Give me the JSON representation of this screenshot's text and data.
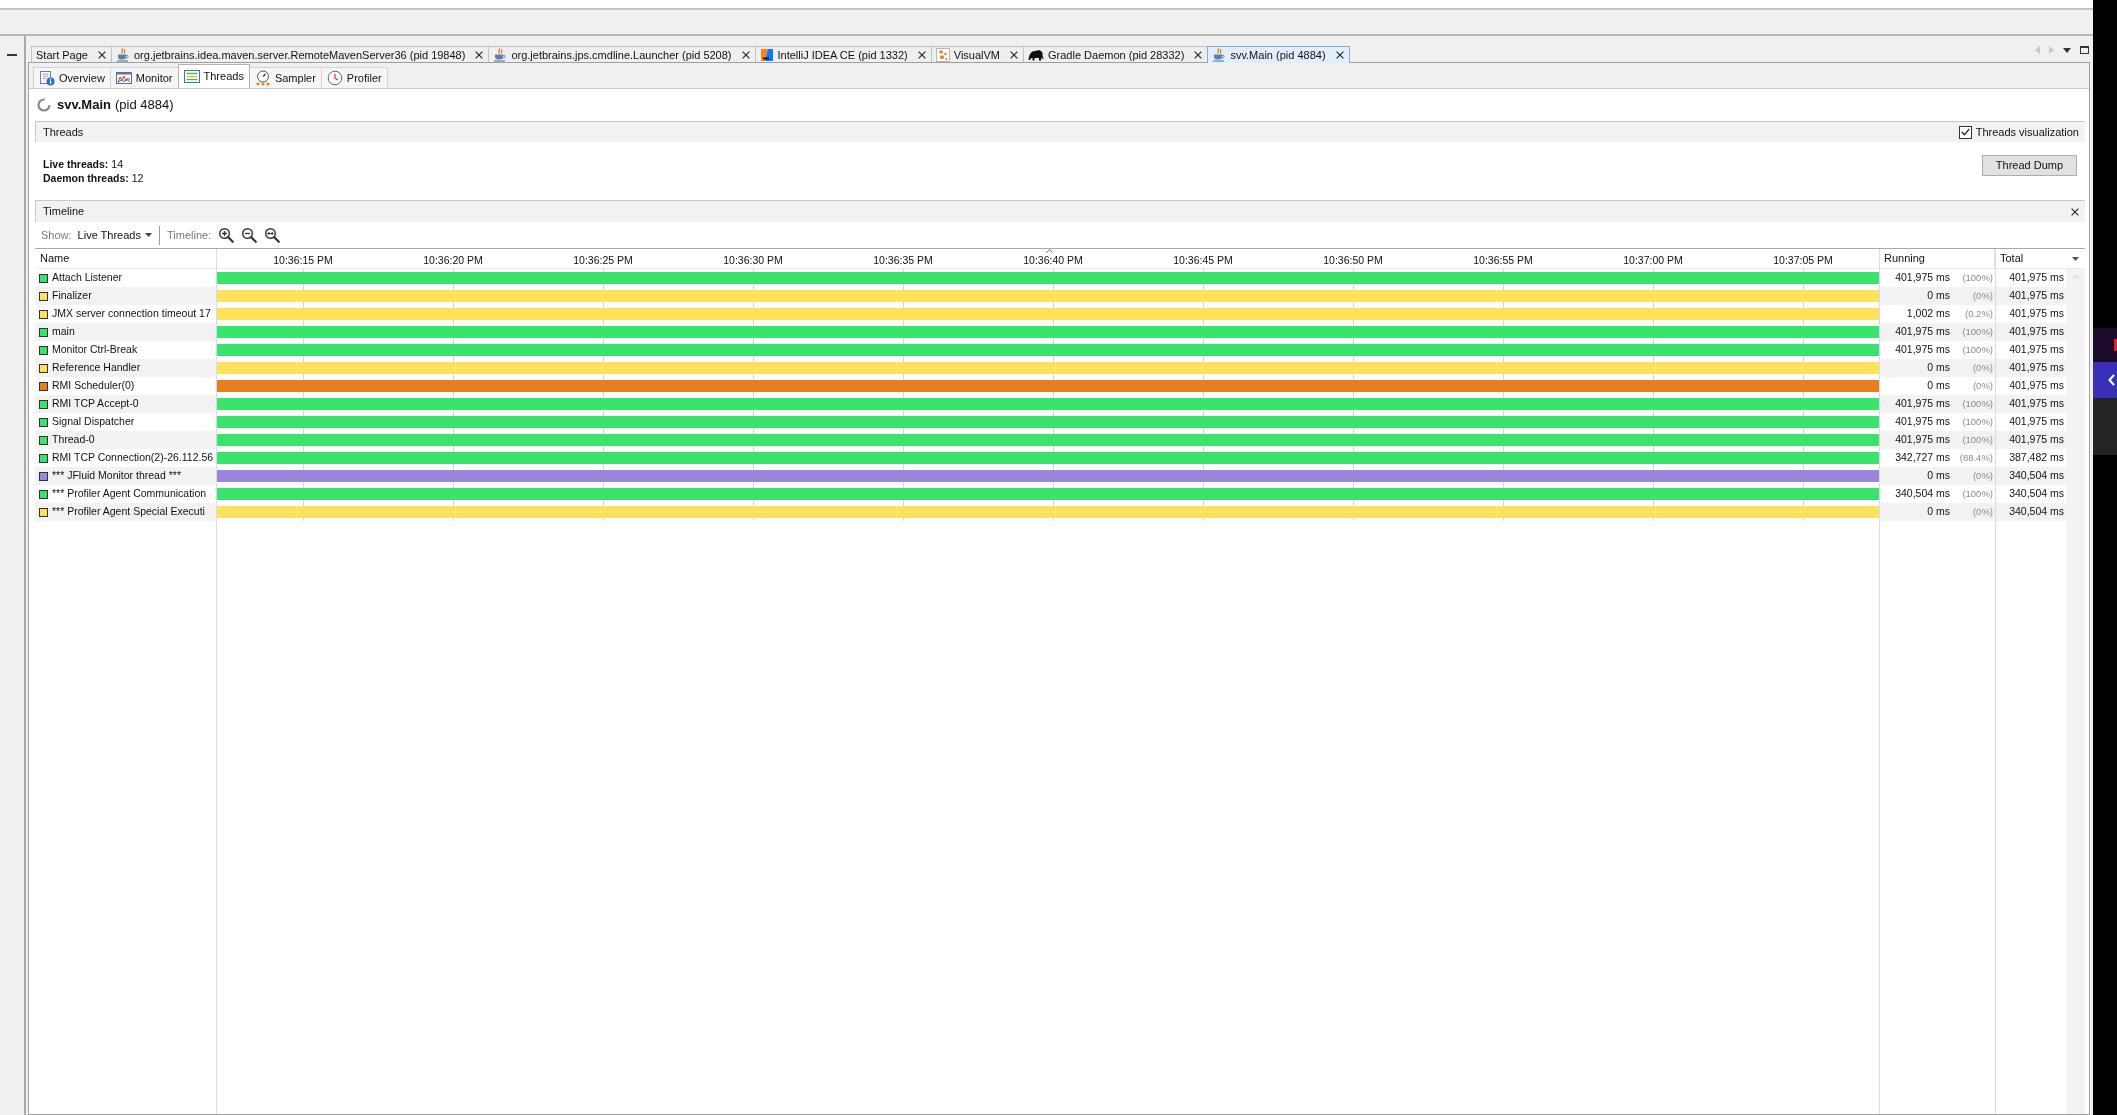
{
  "tabs": [
    {
      "label": "Start Page",
      "kind": "page",
      "selected": false
    },
    {
      "label": "org.jetbrains.idea.maven.server.RemoteMavenServer36 (pid 19848)",
      "kind": "java",
      "selected": false
    },
    {
      "label": "org.jetbrains.jps.cmdline.Launcher (pid 5208)",
      "kind": "java",
      "selected": false
    },
    {
      "label": "IntelliJ IDEA CE (pid 1332)",
      "kind": "intellij",
      "selected": false
    },
    {
      "label": "VisualVM",
      "kind": "visualvm",
      "selected": false
    },
    {
      "label": "Gradle Daemon (pid 28332)",
      "kind": "gradle",
      "selected": false
    },
    {
      "label": "svv.Main (pid 4884)",
      "kind": "java",
      "selected": true
    }
  ],
  "view_tabs": [
    {
      "label": "Overview",
      "kind": "overview",
      "selected": false
    },
    {
      "label": "Monitor",
      "kind": "monitor",
      "selected": false
    },
    {
      "label": "Threads",
      "kind": "threads",
      "selected": true
    },
    {
      "label": "Sampler",
      "kind": "sampler",
      "selected": false
    },
    {
      "label": "Profiler",
      "kind": "profiler",
      "selected": false
    }
  ],
  "process": {
    "name": "svv.Main",
    "pid": "(pid 4884)"
  },
  "threads": {
    "title": "Threads",
    "visualization": {
      "label": "Threads visualization",
      "checked": true
    },
    "stats": [
      {
        "label": "Live threads:",
        "value": "14"
      },
      {
        "label": "Daemon threads:",
        "value": "12"
      }
    ],
    "dump_button": "Thread Dump"
  },
  "timeline": {
    "title": "Timeline",
    "show_label": "Show:",
    "show_value": "Live Threads",
    "zoom_label": "Timeline:",
    "columns": {
      "name": "Name",
      "running": "Running",
      "total": "Total"
    },
    "ticks": [
      "10:36:15 PM",
      "10:36:20 PM",
      "10:36:25 PM",
      "10:36:30 PM",
      "10:36:35 PM",
      "10:36:40 PM",
      "10:36:45 PM",
      "10:36:50 PM",
      "10:36:55 PM",
      "10:37:00 PM",
      "10:37:05 PM"
    ],
    "rows": [
      {
        "name": "Attach Listener",
        "color": "#3ae36a",
        "running": "401,975 ms",
        "share": "(100%)",
        "total": "401,975 ms"
      },
      {
        "name": "Finalizer",
        "color": "#ffe15c",
        "running": "0 ms",
        "share": "(0%)",
        "total": "401,975 ms"
      },
      {
        "name": "JMX server connection timeout 17",
        "color": "#ffe15c",
        "running": "1,002 ms",
        "share": "(0.2%)",
        "total": "401,975 ms"
      },
      {
        "name": "main",
        "color": "#3ae36a",
        "running": "401,975 ms",
        "share": "(100%)",
        "total": "401,975 ms"
      },
      {
        "name": "Monitor Ctrl-Break",
        "color": "#3ae36a",
        "running": "401,975 ms",
        "share": "(100%)",
        "total": "401,975 ms"
      },
      {
        "name": "Reference Handler",
        "color": "#ffe15c",
        "running": "0 ms",
        "share": "(0%)",
        "total": "401,975 ms"
      },
      {
        "name": "RMI Scheduler(0)",
        "color": "#e57f1f",
        "running": "0 ms",
        "share": "(0%)",
        "total": "401,975 ms"
      },
      {
        "name": "RMI TCP Accept-0",
        "color": "#3ae36a",
        "running": "401,975 ms",
        "share": "(100%)",
        "total": "401,975 ms"
      },
      {
        "name": "Signal Dispatcher",
        "color": "#3ae36a",
        "running": "401,975 ms",
        "share": "(100%)",
        "total": "401,975 ms"
      },
      {
        "name": "Thread-0",
        "color": "#3ae36a",
        "running": "401,975 ms",
        "share": "(100%)",
        "total": "401,975 ms"
      },
      {
        "name": "RMI TCP Connection(2)-26.112.56",
        "color": "#3ae36a",
        "running": "342,727 ms",
        "share": "(88.4%)",
        "total": "387,482 ms"
      },
      {
        "name": "*** JFluid Monitor thread ***",
        "color": "#9a86dd",
        "running": "0 ms",
        "share": "(0%)",
        "total": "340,504 ms"
      },
      {
        "name": "*** Profiler Agent Communication",
        "color": "#3ae36a",
        "running": "340,504 ms",
        "share": "(100%)",
        "total": "340,504 ms"
      },
      {
        "name": "*** Profiler Agent Special Executi",
        "color": "#ffe15c",
        "running": "0 ms",
        "share": "(0%)",
        "total": "340,504 ms"
      }
    ]
  }
}
